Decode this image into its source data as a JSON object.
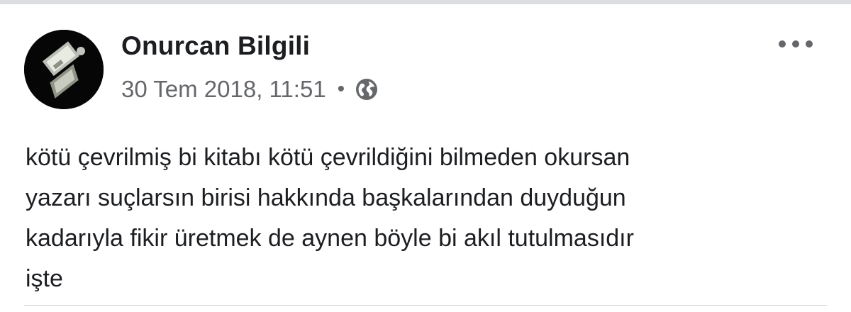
{
  "post": {
    "author": {
      "name": "Onurcan Bilgili",
      "avatar_icon": "profile-picture"
    },
    "timestamp": "30 Tem 2018, 11:51",
    "separator": "•",
    "privacy_icon": "globe-icon",
    "more_icon": "more-options-icon",
    "text_lines": [
      "kötü çevrilmiş bi kitabı kötü çevrildiğini bilmeden okursan",
      "yazarı suçlarsın birisi hakkında başkalarından duyduğun",
      "kadarıyla fikir üretmek de aynen böyle bi akıl tutulmasıdır",
      "işte"
    ]
  },
  "colors": {
    "name_text": "#1c1e21",
    "meta_text": "#65676b",
    "divider": "#dcdde1",
    "background": "#ffffff"
  }
}
